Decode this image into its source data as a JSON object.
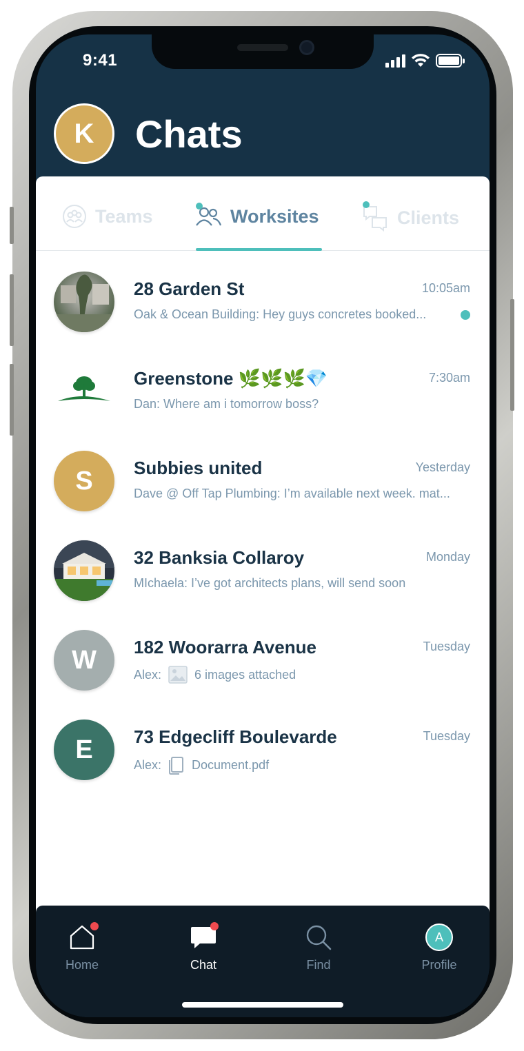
{
  "status_bar": {
    "time": "9:41"
  },
  "header": {
    "avatar_initial": "K",
    "title": "Chats"
  },
  "tabs": [
    {
      "label": "Teams",
      "icon": "team-icon",
      "active": false
    },
    {
      "label": "Worksites",
      "icon": "people-icon",
      "active": true
    },
    {
      "label": "Clients",
      "icon": "chat-bubbles-icon",
      "active": false
    }
  ],
  "chats": [
    {
      "title": "28 Garden St",
      "time": "10:05am",
      "preview": "Oak & Ocean Building: Hey guys concretes booked...",
      "avatar": "photo-garden",
      "unread": true
    },
    {
      "title": "Greenstone 🌿🌿🌿💎",
      "time": "7:30am",
      "preview": "Dan: Where am i tomorrow boss?",
      "avatar": "logo-tree"
    },
    {
      "title": "Subbies united",
      "time": "Yesterday",
      "preview": "Dave @ Off Tap Plumbing: I’m available next week. mat...",
      "avatar_initial": "S"
    },
    {
      "title": "32 Banksia Collaroy",
      "time": "Monday",
      "preview": "MIchaela: I’ve got architects plans, will send soon",
      "avatar": "photo-house"
    },
    {
      "title": "182 Woorarra Avenue",
      "time": "Tuesday",
      "preview_sender": "Alex:",
      "preview_attachment": "6 images attached",
      "attachment_icon": "image-icon",
      "avatar_initial": "W"
    },
    {
      "title": "73 Edgecliff Boulevarde",
      "time": "Tuesday",
      "preview_sender": "Alex:",
      "preview_attachment": "Document.pdf",
      "attachment_icon": "document-icon",
      "avatar_initial": "E"
    }
  ],
  "nav": {
    "home": "Home",
    "chat": "Chat",
    "find": "Find",
    "profile": "Profile",
    "profile_initial": "A"
  },
  "colors": {
    "header_bg": "#163246",
    "accent": "#4ebfbb",
    "avatar_gold": "#d4ac5c",
    "avatar_grey": "#a4aeae",
    "avatar_green": "#3b7468",
    "badge_red": "#ef4a4f"
  }
}
